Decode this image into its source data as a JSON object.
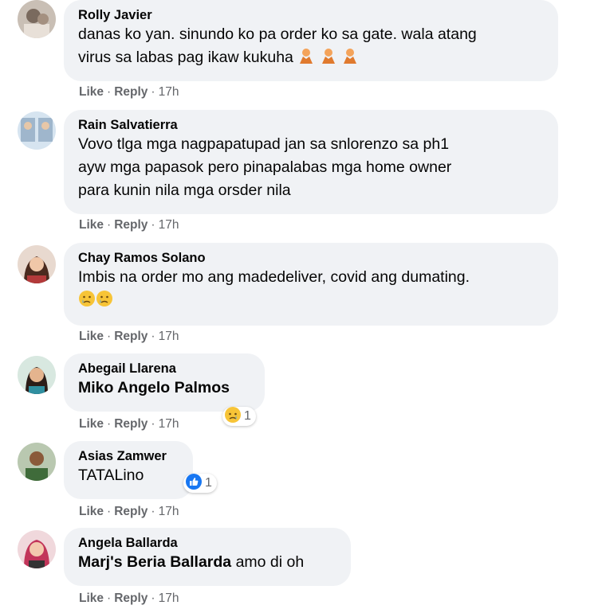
{
  "action_labels": {
    "like": "Like",
    "reply": "Reply",
    "time": "17h",
    "separator": "·"
  },
  "comments": [
    {
      "author": "Rolly Javier",
      "lines": [
        "danas ko yan. sinundo ko pa order ko sa gate. wala atang",
        "virus sa labas pag ikaw kukuha"
      ],
      "emojis": [
        "person-gesturing-no-emoji",
        "person-gesturing-no-emoji",
        "person-gesturing-no-emoji"
      ]
    },
    {
      "author": "Rain Salvatierra",
      "lines": [
        "Vovo tlga mga nagpapatupad jan sa snlorenzo sa ph1",
        "ayw mga papasok pero pinapalabas mga home owner",
        "para kunin nila mga orsder nila"
      ]
    },
    {
      "author": "Chay Ramos Solano",
      "lines": [
        "Imbis na order mo ang madedeliver, covid ang dumating."
      ],
      "emojis": [
        "crying-face-emoji",
        "crying-face-emoji"
      ]
    },
    {
      "author": "Abegail Llarena",
      "mention": "Miko Angelo Palmos",
      "reaction": {
        "icon": "sad-face-icon",
        "count": "1"
      }
    },
    {
      "author": "Asias Zamwer",
      "lines": [
        "TATALino"
      ],
      "reaction": {
        "icon": "thumbs-up-icon",
        "count": "1",
        "color": "#1877f2"
      }
    },
    {
      "author": "Angela Ballarda",
      "mention": "Marj's Beria Ballarda",
      "trailing": "amo di oh"
    }
  ],
  "colors": {
    "bubble": "#f0f2f5",
    "meta": "#65676b",
    "text": "#050505",
    "like_blue": "#1877f2"
  }
}
